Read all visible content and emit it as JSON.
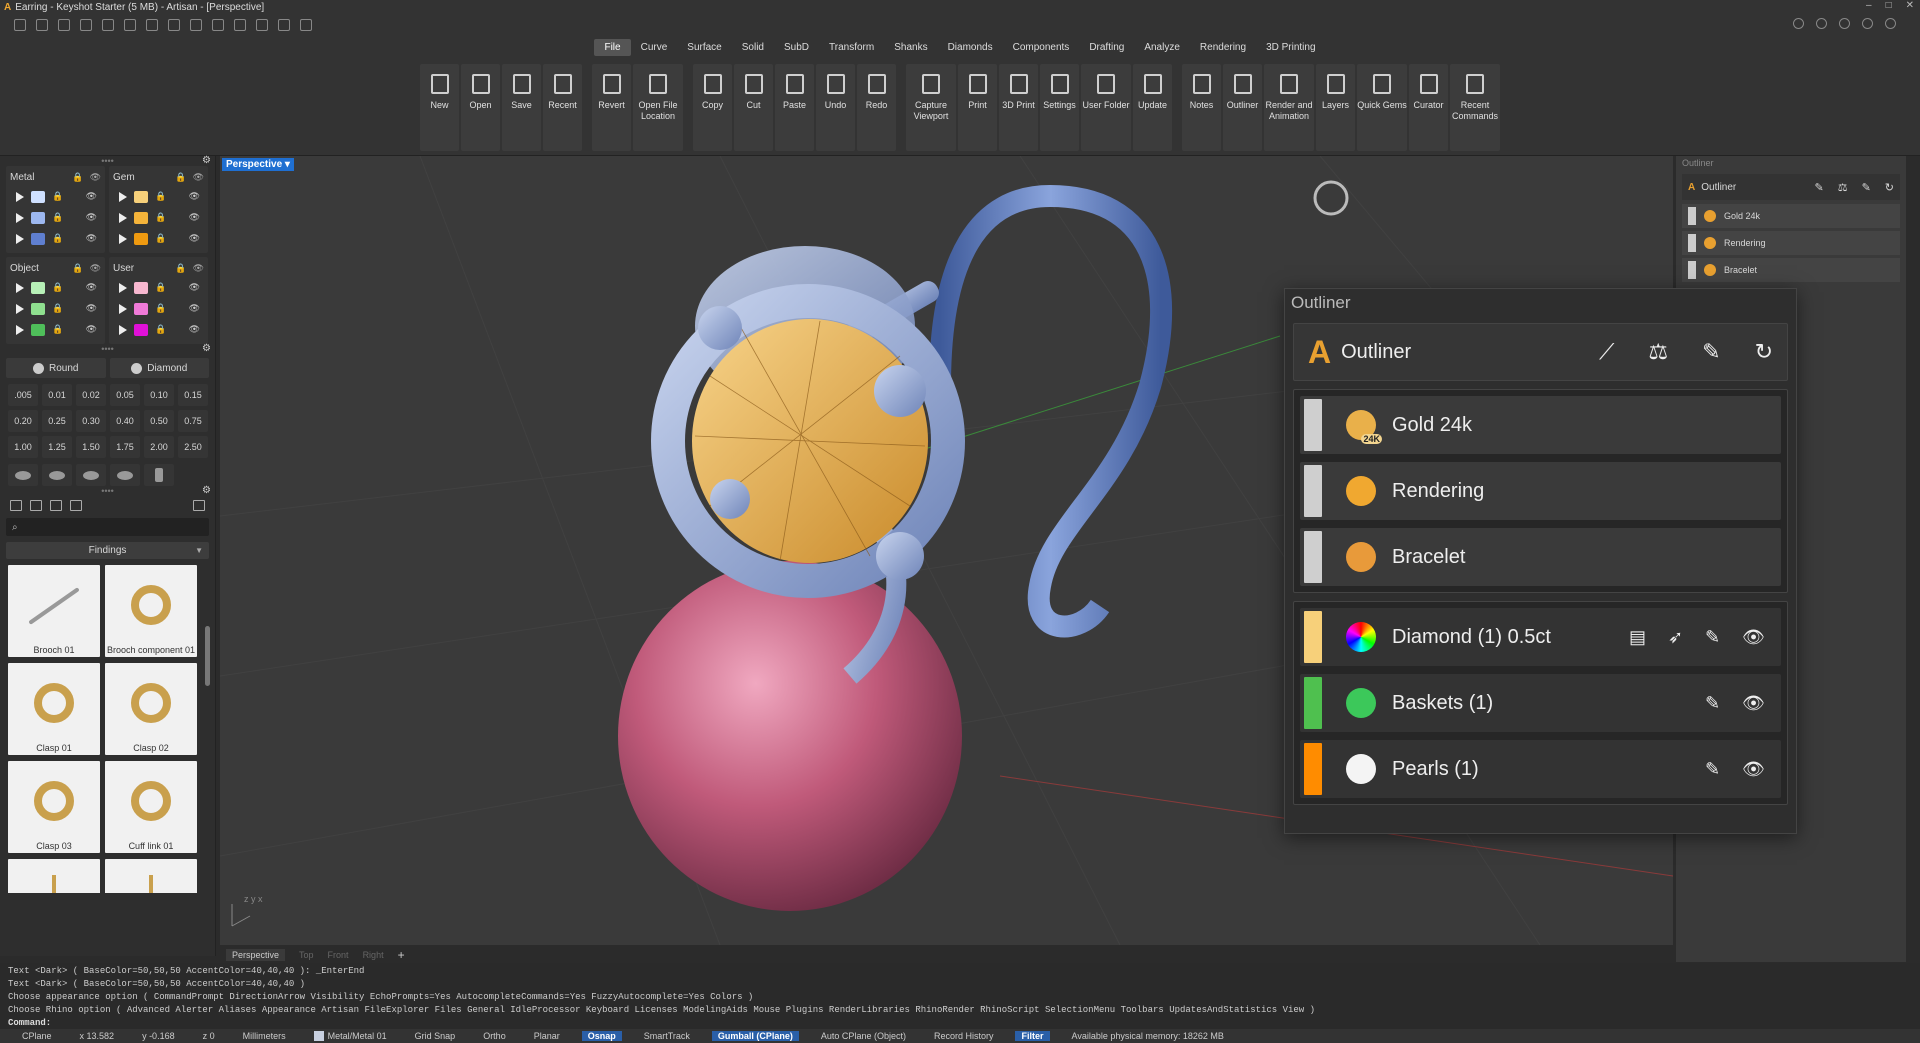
{
  "window": {
    "title": "Earring - Keyshot Starter (5 MB) - Artisan - [Perspective]",
    "controls": [
      "–",
      "□",
      "✕"
    ]
  },
  "menu": {
    "items": [
      "File",
      "Curve",
      "Surface",
      "Solid",
      "SubD",
      "Transform",
      "Shanks",
      "Diamonds",
      "Components",
      "Drafting",
      "Analyze",
      "Rendering",
      "3D Printing"
    ],
    "active": "File"
  },
  "ribbon": {
    "groups": [
      [
        {
          "label": "New"
        },
        {
          "label": "Open"
        },
        {
          "label": "Save"
        },
        {
          "label": "Recent"
        }
      ],
      [
        {
          "label": "Revert"
        },
        {
          "label": "Open File Location"
        }
      ],
      [
        {
          "label": "Copy"
        },
        {
          "label": "Cut"
        },
        {
          "label": "Paste"
        },
        {
          "label": "Undo"
        },
        {
          "label": "Redo"
        }
      ],
      [
        {
          "label": "Capture Viewport"
        },
        {
          "label": "Print"
        },
        {
          "label": "3D Print"
        },
        {
          "label": "Settings"
        },
        {
          "label": "User Folder"
        },
        {
          "label": "Update"
        }
      ],
      [
        {
          "label": "Notes"
        },
        {
          "label": "Outliner"
        },
        {
          "label": "Render and Animation"
        },
        {
          "label": "Layers"
        },
        {
          "label": "Quick Gems"
        },
        {
          "label": "Curator"
        },
        {
          "label": "Recent Commands"
        }
      ]
    ]
  },
  "materials": {
    "metal": {
      "title": "Metal",
      "swatches": [
        "#cfe0ff",
        "#9db8f0",
        "#5f7fd0"
      ]
    },
    "gem": {
      "title": "Gem",
      "swatches": [
        "#f7d07a",
        "#f5b43a",
        "#ef9a10"
      ]
    },
    "object": {
      "title": "Object",
      "swatches": [
        "#b7f0b7",
        "#8fe08f",
        "#4fbf5a"
      ]
    },
    "user": {
      "title": "User",
      "swatches": [
        "#f7b7cf",
        "#f07ad8",
        "#e010d8"
      ]
    }
  },
  "gem_shapes": {
    "round": "Round",
    "diamond": "Diamond"
  },
  "gem_sizes": [
    ".005",
    "0.01",
    "0.02",
    "0.05",
    "0.10",
    "0.15",
    "0.20",
    "0.25",
    "0.30",
    "0.40",
    "0.50",
    "0.75",
    "1.00",
    "1.25",
    "1.50",
    "1.75",
    "2.00",
    "2.50"
  ],
  "library": {
    "category": "Findings",
    "items": [
      "Brooch 01",
      "Brooch component 01",
      "Clasp 01",
      "Clasp 02",
      "Clasp 03",
      "Cuff link 01",
      "",
      ""
    ]
  },
  "viewport": {
    "active": "Perspective",
    "tabs": [
      "Perspective",
      "Top",
      "Front",
      "Right",
      "+"
    ],
    "axis": "z y x"
  },
  "outliner": {
    "title": "Outliner",
    "header": "Outliner",
    "materials": [
      {
        "label": "Gold 24k",
        "color": "#cfcfcf",
        "icon_color": "#e9b04a",
        "badge": "24K"
      },
      {
        "label": "Rendering",
        "color": "#cfcfcf",
        "icon_color": "#f0a830"
      },
      {
        "label": "Bracelet",
        "color": "#cfcfcf",
        "icon_color": "#e89a3a"
      }
    ],
    "objects": [
      {
        "label": "Diamond (1) 0.5ct",
        "color": "#f7d07a"
      },
      {
        "label": "Baskets (1)",
        "color": "#4fc04f"
      },
      {
        "label": "Pearls (1)",
        "color": "#ff8c00"
      }
    ]
  },
  "right_panel": {
    "title": "Outliner",
    "header": "Outliner",
    "items": [
      "Gold 24k",
      "Rendering",
      "Bracelet"
    ]
  },
  "command": {
    "history": [
      "Text <Dark> ( BaseColor=50,50,50  AccentColor=40,40,40 ): _EnterEnd",
      "Text <Dark> ( BaseColor=50,50,50  AccentColor=40,40,40 )",
      "Choose appearance option ( CommandPrompt  DirectionArrow  Visibility  EchoPrompts=Yes  AutocompleteCommands=Yes  FuzzyAutocomplete=Yes  Colors )",
      "Choose Rhino option ( Advanced  Alerter  Aliases  Appearance  Artisan  FileExplorer  Files  General  IdleProcessor  Keyboard  Licenses  ModelingAids  Mouse  Plugins  RenderLibraries  RhinoRender  RhinoScript  SelectionMenu  Toolbars  UpdatesAndStatistics  View )"
    ],
    "prompt": "Command:"
  },
  "status": {
    "cplane": "CPlane",
    "x": "x 13.582",
    "y": "y -0.168",
    "z": "z 0",
    "units": "Millimeters",
    "layer": "Metal/Metal 01",
    "grid_snap": "Grid Snap",
    "ortho": "Ortho",
    "planar": "Planar",
    "osnap": "Osnap",
    "smarttrack": "SmartTrack",
    "gumball": "Gumball (CPlane)",
    "auto_cplane": "Auto CPlane (Object)",
    "record_history": "Record History",
    "filter": "Filter",
    "memory": "Available physical memory: 18262 MB"
  }
}
